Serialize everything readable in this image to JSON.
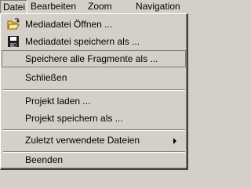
{
  "menubar": {
    "items": [
      {
        "label": "Datei"
      },
      {
        "label": "Bearbeiten"
      },
      {
        "label": "Zoom"
      },
      {
        "label": "Navigation"
      }
    ]
  },
  "file_menu": {
    "items": [
      {
        "label": "Mediadatei Öffnen ...",
        "icon": "open-folder-icon"
      },
      {
        "label": "Mediadatei speichern als ...",
        "icon": "floppy-disk-icon"
      },
      {
        "label": "Speichere alle Fragmente als ...",
        "highlighted": true
      },
      {
        "label": "Schließen"
      },
      {
        "label": "Projekt laden ..."
      },
      {
        "label": "Projekt speichern als ..."
      },
      {
        "label": "Zuletzt verwendete Dateien",
        "has_submenu": true
      },
      {
        "label": "Beenden"
      }
    ]
  }
}
